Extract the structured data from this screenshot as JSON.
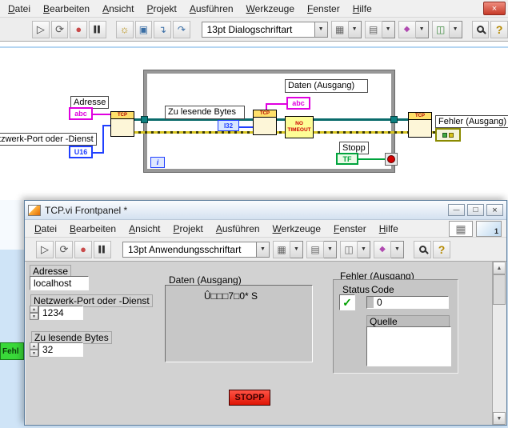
{
  "icons": {
    "run": "▷",
    "runContinuous": "⟳",
    "abort": "●",
    "pause": "▌▌",
    "highlight": "☼",
    "retain": "▣",
    "stepInto": "↴",
    "stepOver": "↷",
    "dropdown": "▼",
    "align": "▦",
    "distribute": "▤",
    "resize": "◫",
    "reorder": "◆",
    "help": "?",
    "minimize": "—",
    "maximize": "□",
    "close": "×",
    "scrollUp": "▲",
    "scrollDown": "▼",
    "checkmark": "✓",
    "grid": "▦"
  },
  "colors": {
    "stringPink": "#e000e0",
    "numericBlue": "#2040ff",
    "booleanGreen": "#00a33d",
    "errorYellow": "#d6c31f",
    "stopRed": "#df1505"
  },
  "blockDiagram": {
    "menu": [
      "Datei",
      "Bearbeiten",
      "Ansicht",
      "Projekt",
      "Ausführen",
      "Werkzeuge",
      "Fenster",
      "Hilfe"
    ],
    "fontSelector": "13pt Dialogschriftart",
    "diagram": {
      "adresseLabel": "Adresse",
      "portLabel": "Netzwerk-Port oder -Dienst",
      "bytesLabel": "Zu lesende Bytes",
      "datenLabel": "Daten (Ausgang)",
      "stoppLabel": "Stopp",
      "fehlerLabel": "Fehler (Ausgang)",
      "noTimeout": "NO TIMEOUT",
      "stringType": "abc",
      "u16Type": "U16",
      "i32Type": "I32",
      "tfType": "TF",
      "iterationTerminal": "i",
      "tcpLabel": "TCP"
    }
  },
  "frontPanel": {
    "title": "TCP.vi Frontpanel *",
    "menu": [
      "Datei",
      "Bearbeiten",
      "Ansicht",
      "Projekt",
      "Ausführen",
      "Werkzeuge",
      "Fenster",
      "Hilfe"
    ],
    "fontSelector": "13pt Anwendungsschriftart",
    "runStateNumber": "1",
    "panel": {
      "adresseLabel": "Adresse",
      "adresseValue": "localhost",
      "portLabel": "Netzwerk-Port oder -Dienst",
      "portValue": "1234",
      "bytesLabel": "Zu lesende Bytes",
      "bytesValue": "32",
      "datenLabel": "Daten (Ausgang)",
      "datenValue": "Û□□□7□0*   S",
      "fehlerLabel": "Fehler (Ausgang)",
      "statusLabel": "Status",
      "codeLabel": "Code",
      "codeValue": "0",
      "quelleLabel": "Quelle",
      "quelleValue": "",
      "stoppButton": "STOPP"
    }
  },
  "background": {
    "partialLabel": "Fehl"
  }
}
